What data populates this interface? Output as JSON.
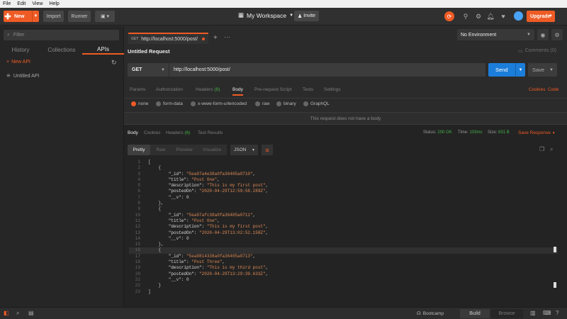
{
  "menu": [
    "File",
    "Edit",
    "View",
    "Help"
  ],
  "toolbar": {
    "new_label": "New",
    "import_label": "Import",
    "runner_label": "Runner",
    "workspace_label": "My Workspace",
    "invite_label": "Invite",
    "upgrade_label": "Upgrade"
  },
  "sidebar": {
    "filter_placeholder": "Filter",
    "tabs": [
      "History",
      "Collections",
      "APIs"
    ],
    "active_tab": "APIs",
    "new_api_label": "New API",
    "items": [
      "Untitled API"
    ]
  },
  "request_tab": {
    "method": "GET",
    "url": "http://localhost:5000/post/"
  },
  "environment": "No Environment",
  "request": {
    "name": "Untitled Request",
    "comments_label": "Comments (0)",
    "method": "GET",
    "url": "http://localhost:5000/post/",
    "send_label": "Send",
    "save_label": "Save",
    "tabs": {
      "params": "Params",
      "authorization": "Authorization",
      "headers": "Headers",
      "headers_count": "(8)",
      "body": "Body",
      "prerequest": "Pre-request Script",
      "tests": "Tests",
      "settings": "Settings"
    },
    "cookies_label": "Cookies",
    "code_label": "Code",
    "body_types": [
      "none",
      "form-data",
      "x-www-form-urlencoded",
      "raw",
      "binary",
      "GraphQL"
    ],
    "selected_body_type": "none",
    "no_body_message": "This request does not have a body"
  },
  "response": {
    "tabs": {
      "body": "Body",
      "cookies": "Cookies",
      "headers": "Headers",
      "headers_count": "(6)",
      "test_results": "Test Results"
    },
    "status_label": "Status:",
    "status_value": "200 OK",
    "time_label": "Time:",
    "time_value": "103ms",
    "size_label": "Size:",
    "size_value": "631 B",
    "save_response_label": "Save Response",
    "view_modes": [
      "Pretty",
      "Raw",
      "Preview",
      "Visualize"
    ],
    "active_view": "Pretty",
    "format": "JSON",
    "lines": [
      {
        "n": "1",
        "t": "["
      },
      {
        "n": "2",
        "t": "    {"
      },
      {
        "n": "3",
        "t": "        \"_id\": \"5ea97a4e38a0fa36405a0710\","
      },
      {
        "n": "4",
        "t": "        \"title\": \"Post One\","
      },
      {
        "n": "5",
        "t": "        \"description\": \"This is my first post\","
      },
      {
        "n": "6",
        "t": "        \"postedOn\": \"2020-04-29T12:59:58.289Z\","
      },
      {
        "n": "7",
        "t": "        \"__v\": 0"
      },
      {
        "n": "8",
        "t": "    },"
      },
      {
        "n": "9",
        "t": "    {"
      },
      {
        "n": "10",
        "t": "        \"_id\": \"5ea97afc38a0fa36405a0711\","
      },
      {
        "n": "11",
        "t": "        \"title\": \"Post One\","
      },
      {
        "n": "12",
        "t": "        \"description\": \"This is my first post\","
      },
      {
        "n": "13",
        "t": "        \"postedOn\": \"2020-04-29T13:02:52.158Z\","
      },
      {
        "n": "14",
        "t": "        \"__v\": 0"
      },
      {
        "n": "15",
        "t": "    },"
      },
      {
        "n": "16",
        "t": "    {"
      },
      {
        "n": "17",
        "t": "        \"_id\": \"5ea9814338a0fa36405a0713\","
      },
      {
        "n": "18",
        "t": "        \"title\": \"Post Three\","
      },
      {
        "n": "19",
        "t": "        \"description\": \"This is my third post\","
      },
      {
        "n": "20",
        "t": "        \"postedOn\": \"2020-04-29T13:29:39.633Z\","
      },
      {
        "n": "21",
        "t": "        \"__v\": 0"
      },
      {
        "n": "22",
        "t": "    }"
      },
      {
        "n": "23",
        "t": "]"
      }
    ]
  },
  "statusbar": {
    "bootcamp_label": "Bootcamp",
    "build_label": "Build",
    "browse_label": "Browse"
  },
  "colors": {
    "accent": "#ef5b25",
    "send": "#1c7edb",
    "status_ok": "#46b04a"
  }
}
